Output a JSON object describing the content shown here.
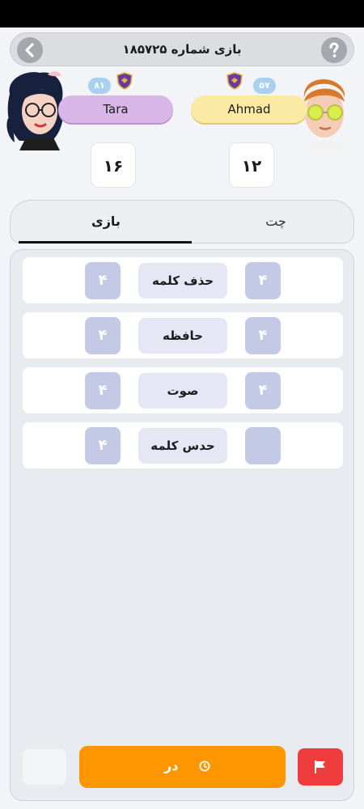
{
  "header": {
    "title": "بازی شماره ۱۸۵۷۲۵",
    "back_icon": "chevron-left-icon",
    "help_icon": "question-icon"
  },
  "players": {
    "left": {
      "name": "Tara",
      "level": "۸۱",
      "score": "۱۶"
    },
    "right": {
      "name": "Ahmad",
      "level": "۵۷",
      "score": "۱۲"
    }
  },
  "tabs": {
    "game": "بازی",
    "chat": "چت"
  },
  "rounds": [
    {
      "label": "حذف کلمه",
      "left": "۴",
      "right": "۴"
    },
    {
      "label": "حافظه",
      "left": "۴",
      "right": "۴"
    },
    {
      "label": "صوت",
      "left": "۴",
      "right": "۴"
    },
    {
      "label": "حدس کلمه",
      "left": "۴",
      "right": ""
    }
  ],
  "footer": {
    "action_label": "در",
    "action_icon": "clock-icon",
    "report_icon": "flag-icon"
  },
  "colors": {
    "accent_orange": "#fd9600",
    "danger_red": "#ef3d3d",
    "cell_lavender": "#c4c9e6",
    "tara_pill": "#d8b6e8",
    "ahmad_pill": "#fbeaa3"
  }
}
